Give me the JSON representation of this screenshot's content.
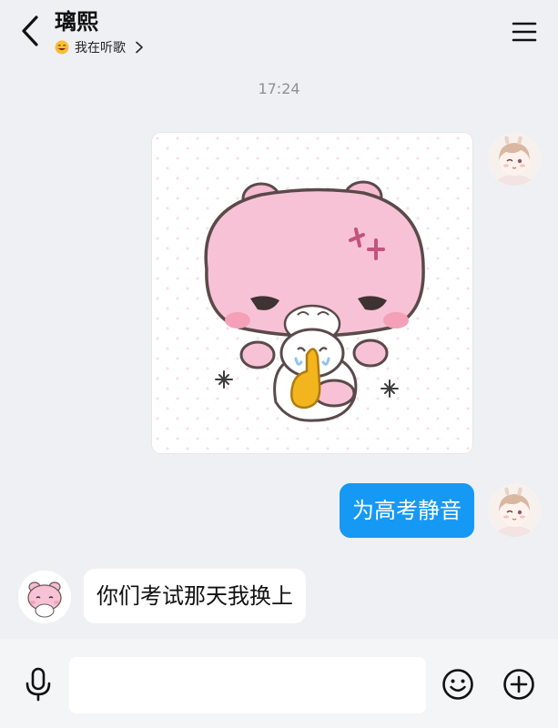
{
  "header": {
    "contact_name": "璃熙",
    "status_text": "我在听歌",
    "status_icon": "grinning-face-icon"
  },
  "chat": {
    "timestamp": "17:24",
    "messages": [
      {
        "from": "me",
        "kind": "sticker",
        "sticker": "pink-bear-hush-sticker"
      },
      {
        "from": "me",
        "kind": "text",
        "text": "为高考静音"
      },
      {
        "from": "them",
        "kind": "text",
        "text": "你们考试那天我换上"
      }
    ]
  },
  "input_bar": {
    "placeholder": "",
    "value": ""
  },
  "colors": {
    "background": "#eef0f4",
    "outgoing_bubble": "#1698f5",
    "incoming_bubble": "#ffffff",
    "timestamp": "#8d9097"
  }
}
